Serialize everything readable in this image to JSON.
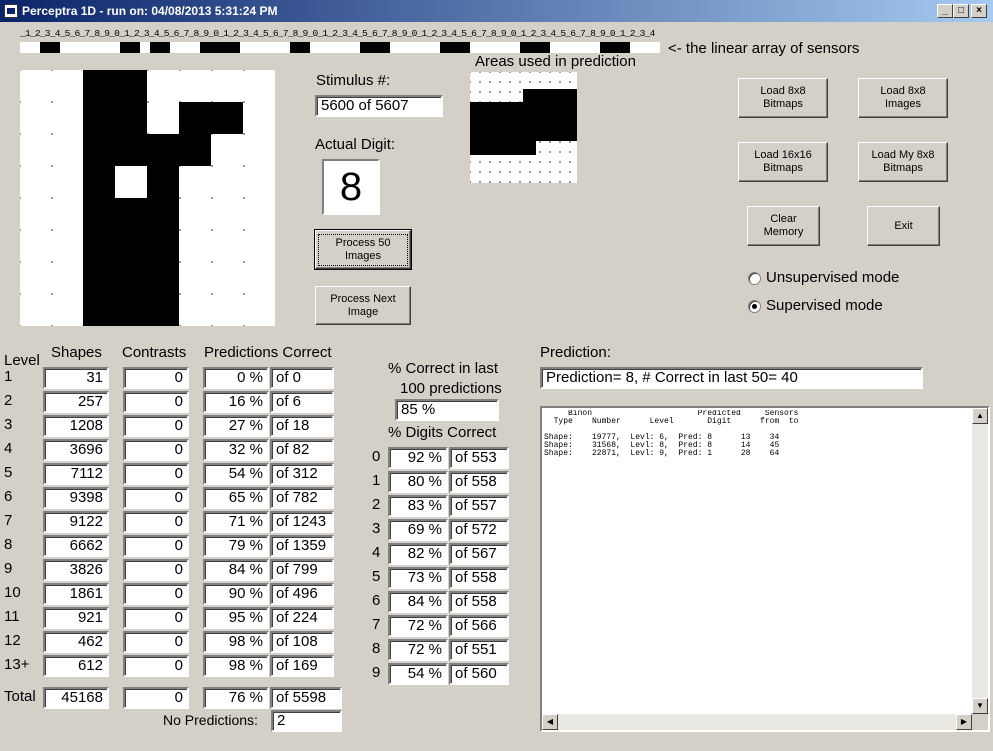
{
  "window": {
    "title": "Perceptra 1D - run on: 04/08/2013  5:31:24 PM"
  },
  "sensor": {
    "labels": "_1_2_3_4_5_6_7_8_9_0_1_2_3_4_5_6_7_8_9_0_1_2_3_4_5_6_7_8_9_0_1_2_3_4_5_6_7_8_9_0_1_2_3_4_5_6_7_8_9_0_1_2_3_4_5_6_7_8_9_0_1_2_3_4",
    "caption": "<- the linear array of sensors"
  },
  "stimulus": {
    "label": "Stimulus #:",
    "value": "5600  of 5607"
  },
  "actual": {
    "label": "Actual Digit:",
    "digit": "8"
  },
  "areas_label": "Areas used in prediction",
  "buttons": {
    "process50": "Process 50 Images",
    "process_next": "Process Next Image",
    "load8b": "Load 8x8 Bitmaps",
    "load8i": "Load 8x8 Images",
    "load16": "Load 16x16 Bitmaps",
    "loadmy": "Load My 8x8 Bitmaps",
    "clear": "Clear Memory",
    "exit": "Exit"
  },
  "modes": {
    "unsupervised": "Unsupervised mode",
    "supervised": "Supervised mode"
  },
  "headers": {
    "level": "Level",
    "shapes": "Shapes",
    "contrasts": "Contrasts",
    "predictions": "Predictions Correct"
  },
  "levels": [
    {
      "level": "1",
      "shapes": "31",
      "contrasts": "0",
      "pct": "0 %",
      "of": "of 0"
    },
    {
      "level": "2",
      "shapes": "257",
      "contrasts": "0",
      "pct": "16 %",
      "of": "of 6"
    },
    {
      "level": "3",
      "shapes": "1208",
      "contrasts": "0",
      "pct": "27 %",
      "of": "of 18"
    },
    {
      "level": "4",
      "shapes": "3696",
      "contrasts": "0",
      "pct": "32 %",
      "of": "of 82"
    },
    {
      "level": "5",
      "shapes": "7112",
      "contrasts": "0",
      "pct": "54 %",
      "of": "of 312"
    },
    {
      "level": "6",
      "shapes": "9398",
      "contrasts": "0",
      "pct": "65 %",
      "of": "of 782"
    },
    {
      "level": "7",
      "shapes": "9122",
      "contrasts": "0",
      "pct": "71 %",
      "of": "of 1243"
    },
    {
      "level": "8",
      "shapes": "6662",
      "contrasts": "0",
      "pct": "79 %",
      "of": "of 1359"
    },
    {
      "level": "9",
      "shapes": "3826",
      "contrasts": "0",
      "pct": "84 %",
      "of": "of 799"
    },
    {
      "level": "10",
      "shapes": "1861",
      "contrasts": "0",
      "pct": "90 %",
      "of": "of 496"
    },
    {
      "level": "11",
      "shapes": "921",
      "contrasts": "0",
      "pct": "95 %",
      "of": "of 224"
    },
    {
      "level": "12",
      "shapes": "462",
      "contrasts": "0",
      "pct": "98 %",
      "of": "of 108"
    },
    {
      "level": "13+",
      "shapes": "612",
      "contrasts": "0",
      "pct": "98 %",
      "of": "of 169"
    }
  ],
  "total": {
    "label": "Total",
    "shapes": "45168",
    "contrasts": "0",
    "pct": "76 %",
    "of": "of 5598"
  },
  "no_predictions": {
    "label": "No Predictions:",
    "value": "2"
  },
  "last100": {
    "line1": "% Correct in last",
    "line2": "100 predictions",
    "value": "85 %"
  },
  "digits_header": "% Digits Correct",
  "digits": [
    {
      "digit": "0",
      "pct": "92 %",
      "of": "of 553"
    },
    {
      "digit": "1",
      "pct": "80 %",
      "of": "of 558"
    },
    {
      "digit": "2",
      "pct": "83 %",
      "of": "of 557"
    },
    {
      "digit": "3",
      "pct": "69 %",
      "of": "of 572"
    },
    {
      "digit": "4",
      "pct": "82 %",
      "of": "of 567"
    },
    {
      "digit": "5",
      "pct": "73 %",
      "of": "of 558"
    },
    {
      "digit": "6",
      "pct": "84 %",
      "of": "of 558"
    },
    {
      "digit": "7",
      "pct": "72 %",
      "of": "of 566"
    },
    {
      "digit": "8",
      "pct": "72 %",
      "of": "of 551"
    },
    {
      "digit": "9",
      "pct": "54 %",
      "of": "of 560"
    }
  ],
  "prediction": {
    "label": "Prediction:",
    "value": "Prediction= 8, # Correct in last 50= 40"
  },
  "log": {
    "text": "     Binon                      Predicted     Sensors\n  Type    Number      Level       Digit      from  to\n\nShape:    19777,  Levl: 6,  Pred: 8      13    34\nShape:    31568,  Levl: 8,  Pred: 8      14    45\nShape:    22871,  Levl: 9,  Pred: 1      28    64"
  }
}
